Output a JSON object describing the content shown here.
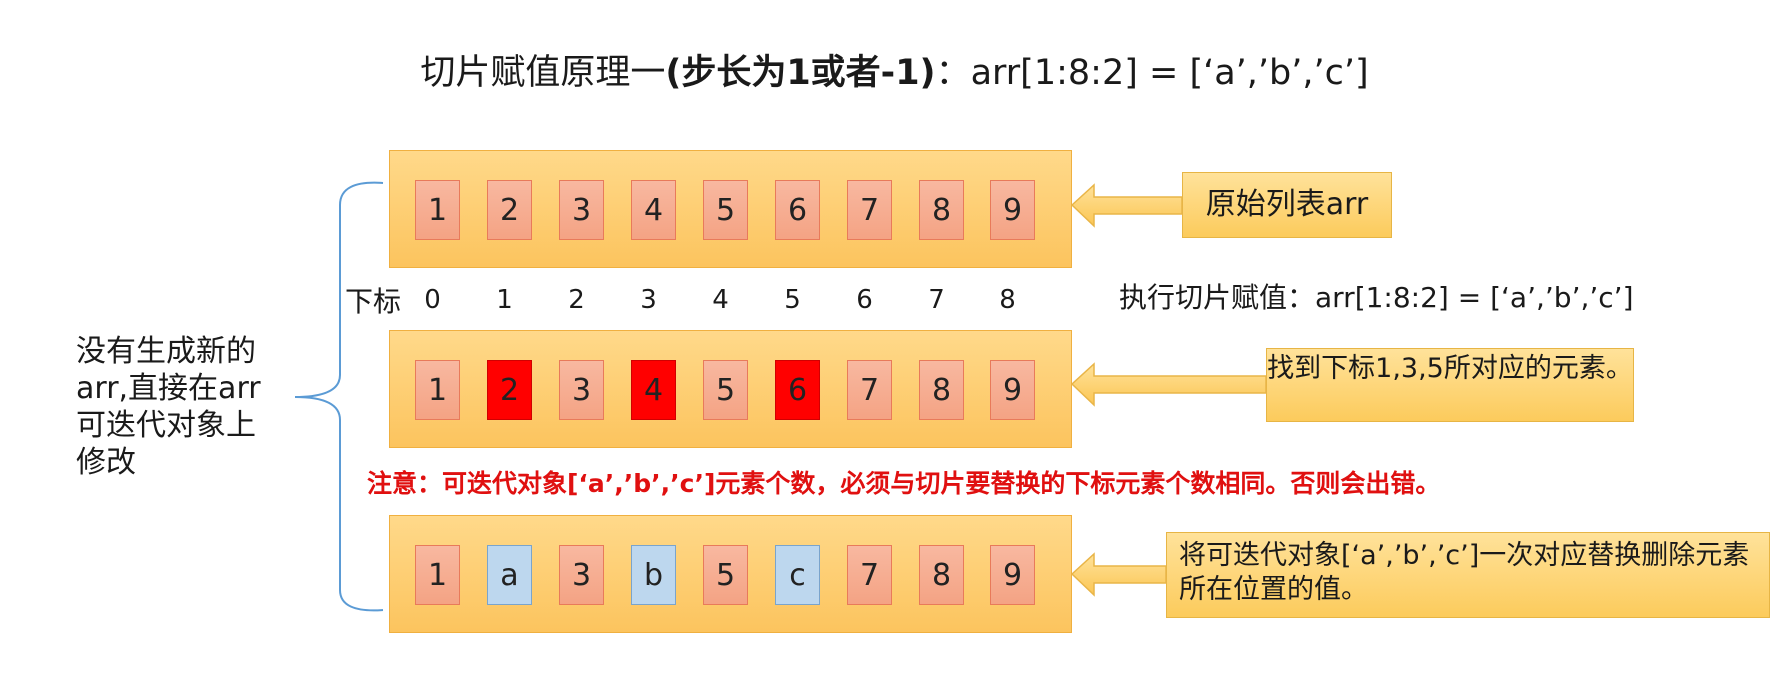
{
  "title": {
    "part1": "切片赋值原理一",
    "part2": "(步长为1或者-1)",
    "part3": "：arr[1:8:2] = [‘a’,’b’,’c’]"
  },
  "row_original": [
    "1",
    "2",
    "3",
    "4",
    "5",
    "6",
    "7",
    "8",
    "9"
  ],
  "row_marked": [
    "1",
    "2",
    "3",
    "4",
    "5",
    "6",
    "7",
    "8",
    "9"
  ],
  "row_marked_highlighted_indices": [
    1,
    3,
    5
  ],
  "row_result": [
    "1",
    "a",
    "3",
    "b",
    "5",
    "c",
    "7",
    "8",
    "9"
  ],
  "row_result_replaced_indices": [
    1,
    3,
    5
  ],
  "index_label": "下标",
  "indices": [
    "0",
    "1",
    "2",
    "3",
    "4",
    "5",
    "6",
    "7",
    "8"
  ],
  "notes": {
    "original": "原始列表arr",
    "operation": "执行切片赋值：arr[1:8:2] = [‘a’,’b’,’c’]",
    "find": "找到下标1,3,5所对应的元素。",
    "replace": "将可迭代对象[‘a’,’b’,’c’]一次对应替换删除元素所在位置的值。"
  },
  "warning": "注意：可迭代对象[‘a’,’b’,’c’]元素个数，必须与切片要替换的下标元素个数相同。否则会出错。",
  "side_note": "没有生成新的arr,直接在arr可迭代对象上修改",
  "colors": {
    "band": "#fcc45e",
    "cell": "#f4a384",
    "highlight": "#ff0000",
    "replaced": "#bdd7ee",
    "warning": "#e01010",
    "brace": "#5b9bd5"
  }
}
